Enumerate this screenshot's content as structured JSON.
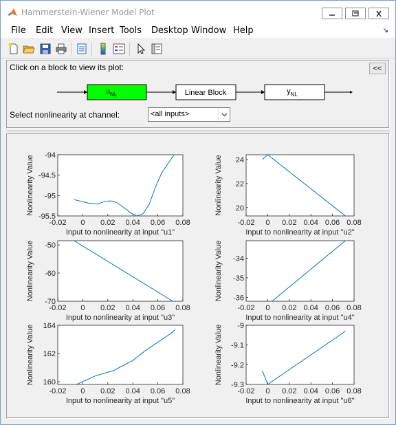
{
  "window": {
    "title": "Hammerstein-Wiener Model Plot"
  },
  "menu": [
    "File",
    "Edit",
    "View",
    "Insert",
    "Tools",
    "Desktop",
    "Window",
    "Help"
  ],
  "toolbar": {
    "icons": [
      "new-file-icon",
      "open-folder-icon",
      "save-icon",
      "print-icon",
      "print-preview-icon",
      "colorbar-icon",
      "legend-icon",
      "pointer-icon",
      "property-editor-icon"
    ]
  },
  "control": {
    "instruction": "Click on a block to view its plot:",
    "collapse_label": "<<",
    "blocks": {
      "input_nl": {
        "main": "u",
        "sub": "NL"
      },
      "linear": "Linear Block",
      "output_nl": {
        "main": "y",
        "sub": "NL"
      }
    },
    "select_label": "Select nonlinearity at channel:",
    "select_value": "<all inputs>"
  },
  "colors": {
    "line": "#0072bd",
    "active_block": "#00ff00"
  },
  "chart_data": [
    {
      "type": "line",
      "xlabel": "Input to nonlinearity at input \"u1\"",
      "ylabel": "Nonlinearity Value",
      "xlim": [
        -0.02,
        0.08
      ],
      "ylim": [
        -95.5,
        -94
      ],
      "xticks": [
        "-0.02",
        "0",
        "0.02",
        "0.04",
        "0.06",
        "0.08"
      ],
      "yticks": [
        "-94",
        "-94.5",
        "-95",
        "-95.5"
      ],
      "ytick_values": [
        -94,
        -94.5,
        -95,
        -95.5
      ],
      "x": [
        -0.007,
        0.0,
        0.005,
        0.012,
        0.017,
        0.022,
        0.027,
        0.033,
        0.038,
        0.043,
        0.048,
        0.053,
        0.058,
        0.063,
        0.068,
        0.073
      ],
      "y": [
        -95.1,
        -95.15,
        -95.19,
        -95.21,
        -95.15,
        -95.13,
        -95.17,
        -95.3,
        -95.42,
        -95.5,
        -95.45,
        -95.22,
        -94.8,
        -94.45,
        -94.22,
        -94.0
      ]
    },
    {
      "type": "line",
      "xlabel": "Input to nonlinearity at input \"u2\"",
      "ylabel": "Nonlinearity Value",
      "xlim": [
        -0.02,
        0.08
      ],
      "ylim": [
        19.3,
        24.4
      ],
      "xticks": [
        "-0.02",
        "0",
        "0.02",
        "0.04",
        "0.06",
        "0.08"
      ],
      "yticks": [
        "24",
        "22",
        "20"
      ],
      "ytick_values": [
        24,
        22,
        20
      ],
      "x": [
        -0.005,
        0.0,
        0.072
      ],
      "y": [
        24.0,
        24.4,
        19.3
      ]
    },
    {
      "type": "line",
      "xlabel": "Input to nonlinearity at input \"u3\"",
      "ylabel": "Nonlinearity Value",
      "xlim": [
        -0.02,
        0.08
      ],
      "ylim": [
        -70,
        -48.5
      ],
      "xticks": [
        "-0.02",
        "0",
        "0.02",
        "0.04",
        "0.06",
        "0.08"
      ],
      "yticks": [
        "-50",
        "-60",
        "-70"
      ],
      "ytick_values": [
        -50,
        -60,
        -70
      ],
      "x": [
        -0.007,
        0.072
      ],
      "y": [
        -48.5,
        -70.0
      ]
    },
    {
      "type": "line",
      "xlabel": "Input to nonlinearity at input \"u4\"",
      "ylabel": "Nonlinearity Value",
      "xlim": [
        -0.02,
        0.08
      ],
      "ylim": [
        -36.2,
        -33.1
      ],
      "xticks": [
        "-0.02",
        "0",
        "0.02",
        "0.04",
        "0.06",
        "0.08"
      ],
      "yticks": [
        "-34",
        "-35",
        "-36"
      ],
      "ytick_values": [
        -34,
        -35,
        -36
      ],
      "x": [
        -0.005,
        0.0,
        0.004,
        0.072
      ],
      "y": [
        -36.2,
        -36.22,
        -36.2,
        -33.1
      ]
    },
    {
      "type": "line",
      "xlabel": "Input to nonlinearity at input \"u5\"",
      "ylabel": "Nonlinearity Value",
      "xlim": [
        -0.02,
        0.08
      ],
      "ylim": [
        159.8,
        164
      ],
      "xticks": [
        "-0.02",
        "0",
        "0.02",
        "0.04",
        "0.06",
        "0.08"
      ],
      "yticks": [
        "164",
        "162",
        "160"
      ],
      "ytick_values": [
        164,
        162,
        160
      ],
      "x": [
        -0.005,
        0.01,
        0.025,
        0.04,
        0.05,
        0.06,
        0.07,
        0.074
      ],
      "y": [
        159.8,
        160.4,
        160.8,
        161.5,
        162.2,
        162.8,
        163.4,
        163.7
      ]
    },
    {
      "type": "line",
      "xlabel": "Input to nonlinearity at input \"u6\"",
      "ylabel": "Nonlinearity Value",
      "xlim": [
        -0.02,
        0.08
      ],
      "ylim": [
        -9.3,
        -9
      ],
      "xticks": [
        "-0.02",
        "0",
        "0.02",
        "0.04",
        "0.06",
        "0.08"
      ],
      "yticks": [
        "-9",
        "-9.1",
        "-9.2",
        "-9.3"
      ],
      "ytick_values": [
        -9,
        -9.1,
        -9.2,
        -9.3
      ],
      "x": [
        -0.005,
        0.0,
        0.072
      ],
      "y": [
        -9.23,
        -9.3,
        -9.03
      ]
    }
  ]
}
